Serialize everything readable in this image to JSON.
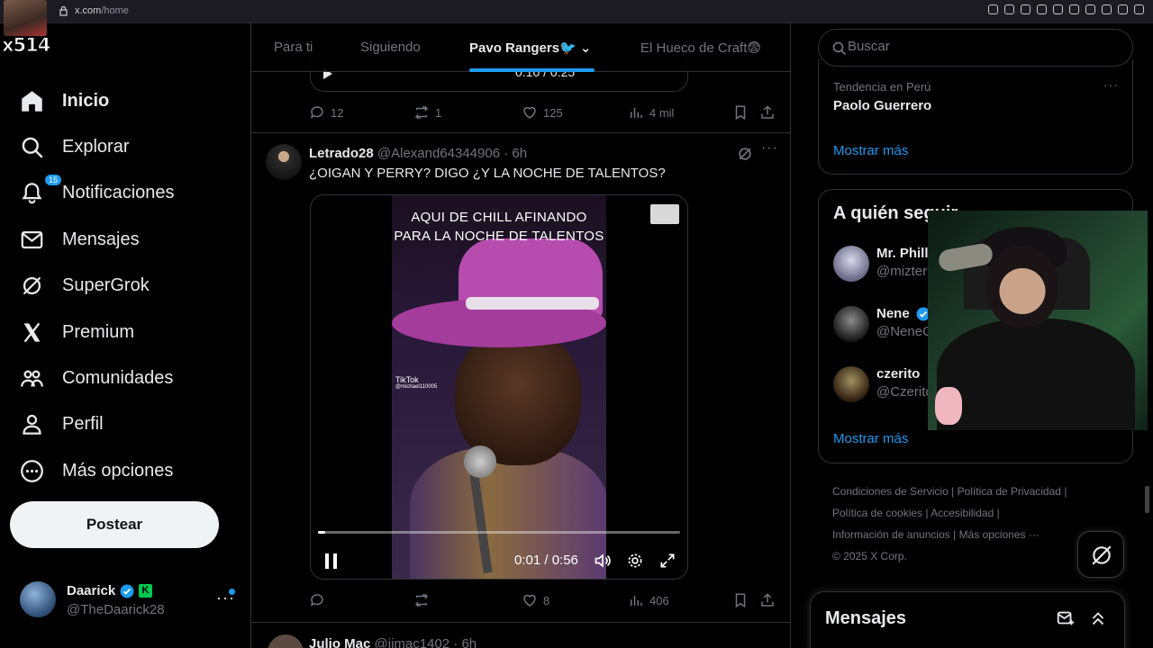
{
  "browser": {
    "url_host": "x.com",
    "url_path": "/home"
  },
  "stream_overlay": {
    "tag": "x514"
  },
  "nav": {
    "items": [
      {
        "label": "Inicio",
        "icon": "home-icon"
      },
      {
        "label": "Explorar",
        "icon": "search-icon"
      },
      {
        "label": "Notificaciones",
        "icon": "bell-icon",
        "badge": "15"
      },
      {
        "label": "Mensajes",
        "icon": "mail-icon"
      },
      {
        "label": "SuperGrok",
        "icon": "grok-icon"
      },
      {
        "label": "Premium",
        "icon": "x-logo-icon"
      },
      {
        "label": "Comunidades",
        "icon": "people-icon"
      },
      {
        "label": "Perfil",
        "icon": "person-icon"
      },
      {
        "label": "Más opciones",
        "icon": "more-circle-icon"
      }
    ],
    "post_button": "Postear"
  },
  "account": {
    "name": "Daarick",
    "badge": "K",
    "handle": "@TheDaarick28",
    "more": "···"
  },
  "tabs": [
    {
      "label": "Para ti"
    },
    {
      "label": "Siguiendo"
    },
    {
      "label": "Pavo Rangers🐦 ⌄"
    },
    {
      "label": "El Hueco de Craft😨"
    }
  ],
  "prev_tweet": {
    "time": "0:10 / 0:25",
    "replies": "12",
    "reposts": "1",
    "likes": "125",
    "views": "4 mil"
  },
  "tweet": {
    "name": "Letrado28",
    "handle": "@Alexand64344906",
    "time": "· 6h",
    "text": "¿OIGAN Y PERRY? DIGO ¿Y LA NOCHE DE TALENTOS?",
    "more": "···",
    "video": {
      "caption_line1": "AQUI DE CHILL AFINANDO",
      "caption_line2": "PARA LA NOCHE DE TALENTOS",
      "tiktok": "TikTok",
      "tiktok_user": "@michael110005",
      "time": "0:01 / 0:56",
      "progress": 0.02
    },
    "replies": "",
    "reposts": "",
    "likes": "8",
    "views": "406"
  },
  "next_tweet": {
    "name": "Julio Mac",
    "meta": "@jjmac1402 · 6h"
  },
  "right": {
    "search_placeholder": "Buscar",
    "trend": {
      "context": "Tendencia en Perú",
      "topic": "Paolo Guerrero",
      "more": "···",
      "show_more": "Mostrar más"
    },
    "follow": {
      "title": "A quién seguir",
      "items": [
        {
          "name": "Mr. Phill",
          "handle": "@mizter"
        },
        {
          "name": "Nene",
          "handle": "@NeneC"
        },
        {
          "name": "czerito",
          "handle": "@Czerito"
        }
      ],
      "show_more": "Mostrar más"
    },
    "footer": [
      "Condiciones de Servicio",
      "|",
      "Política de Privacidad",
      "|",
      "Política de cookies",
      "|",
      "Accesibilidad",
      "|",
      "Información de anuncios",
      "|",
      "Más opciones ···",
      "© 2025 X Corp."
    ],
    "messages_title": "Mensajes"
  },
  "colors": {
    "accent": "#1d9bf0",
    "background": "#000000",
    "border": "#2f3336",
    "muted": "#71767b"
  }
}
